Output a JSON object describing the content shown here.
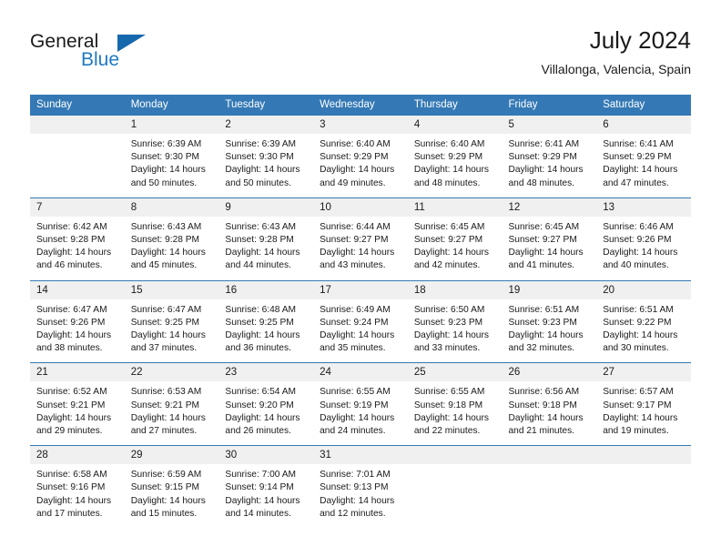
{
  "brand": {
    "name_part1": "General",
    "name_part2": "Blue",
    "triangle_icon": "triangle-icon",
    "accent_color": "#1668ad"
  },
  "header": {
    "title": "July 2024",
    "location": "Villalonga, Valencia, Spain"
  },
  "colors": {
    "header_row_bg": "#3479b5",
    "daynum_bg": "#f0f0f0",
    "week_divider": "#3479b5",
    "text": "#1a1a1a",
    "header_text": "#ffffff"
  },
  "weekdays": [
    "Sunday",
    "Monday",
    "Tuesday",
    "Wednesday",
    "Thursday",
    "Friday",
    "Saturday"
  ],
  "weeks": [
    [
      {
        "day": "",
        "lines": []
      },
      {
        "day": "1",
        "lines": [
          "Sunrise: 6:39 AM",
          "Sunset: 9:30 PM",
          "Daylight: 14 hours",
          "and 50 minutes."
        ]
      },
      {
        "day": "2",
        "lines": [
          "Sunrise: 6:39 AM",
          "Sunset: 9:30 PM",
          "Daylight: 14 hours",
          "and 50 minutes."
        ]
      },
      {
        "day": "3",
        "lines": [
          "Sunrise: 6:40 AM",
          "Sunset: 9:29 PM",
          "Daylight: 14 hours",
          "and 49 minutes."
        ]
      },
      {
        "day": "4",
        "lines": [
          "Sunrise: 6:40 AM",
          "Sunset: 9:29 PM",
          "Daylight: 14 hours",
          "and 48 minutes."
        ]
      },
      {
        "day": "5",
        "lines": [
          "Sunrise: 6:41 AM",
          "Sunset: 9:29 PM",
          "Daylight: 14 hours",
          "and 48 minutes."
        ]
      },
      {
        "day": "6",
        "lines": [
          "Sunrise: 6:41 AM",
          "Sunset: 9:29 PM",
          "Daylight: 14 hours",
          "and 47 minutes."
        ]
      }
    ],
    [
      {
        "day": "7",
        "lines": [
          "Sunrise: 6:42 AM",
          "Sunset: 9:28 PM",
          "Daylight: 14 hours",
          "and 46 minutes."
        ]
      },
      {
        "day": "8",
        "lines": [
          "Sunrise: 6:43 AM",
          "Sunset: 9:28 PM",
          "Daylight: 14 hours",
          "and 45 minutes."
        ]
      },
      {
        "day": "9",
        "lines": [
          "Sunrise: 6:43 AM",
          "Sunset: 9:28 PM",
          "Daylight: 14 hours",
          "and 44 minutes."
        ]
      },
      {
        "day": "10",
        "lines": [
          "Sunrise: 6:44 AM",
          "Sunset: 9:27 PM",
          "Daylight: 14 hours",
          "and 43 minutes."
        ]
      },
      {
        "day": "11",
        "lines": [
          "Sunrise: 6:45 AM",
          "Sunset: 9:27 PM",
          "Daylight: 14 hours",
          "and 42 minutes."
        ]
      },
      {
        "day": "12",
        "lines": [
          "Sunrise: 6:45 AM",
          "Sunset: 9:27 PM",
          "Daylight: 14 hours",
          "and 41 minutes."
        ]
      },
      {
        "day": "13",
        "lines": [
          "Sunrise: 6:46 AM",
          "Sunset: 9:26 PM",
          "Daylight: 14 hours",
          "and 40 minutes."
        ]
      }
    ],
    [
      {
        "day": "14",
        "lines": [
          "Sunrise: 6:47 AM",
          "Sunset: 9:26 PM",
          "Daylight: 14 hours",
          "and 38 minutes."
        ]
      },
      {
        "day": "15",
        "lines": [
          "Sunrise: 6:47 AM",
          "Sunset: 9:25 PM",
          "Daylight: 14 hours",
          "and 37 minutes."
        ]
      },
      {
        "day": "16",
        "lines": [
          "Sunrise: 6:48 AM",
          "Sunset: 9:25 PM",
          "Daylight: 14 hours",
          "and 36 minutes."
        ]
      },
      {
        "day": "17",
        "lines": [
          "Sunrise: 6:49 AM",
          "Sunset: 9:24 PM",
          "Daylight: 14 hours",
          "and 35 minutes."
        ]
      },
      {
        "day": "18",
        "lines": [
          "Sunrise: 6:50 AM",
          "Sunset: 9:23 PM",
          "Daylight: 14 hours",
          "and 33 minutes."
        ]
      },
      {
        "day": "19",
        "lines": [
          "Sunrise: 6:51 AM",
          "Sunset: 9:23 PM",
          "Daylight: 14 hours",
          "and 32 minutes."
        ]
      },
      {
        "day": "20",
        "lines": [
          "Sunrise: 6:51 AM",
          "Sunset: 9:22 PM",
          "Daylight: 14 hours",
          "and 30 minutes."
        ]
      }
    ],
    [
      {
        "day": "21",
        "lines": [
          "Sunrise: 6:52 AM",
          "Sunset: 9:21 PM",
          "Daylight: 14 hours",
          "and 29 minutes."
        ]
      },
      {
        "day": "22",
        "lines": [
          "Sunrise: 6:53 AM",
          "Sunset: 9:21 PM",
          "Daylight: 14 hours",
          "and 27 minutes."
        ]
      },
      {
        "day": "23",
        "lines": [
          "Sunrise: 6:54 AM",
          "Sunset: 9:20 PM",
          "Daylight: 14 hours",
          "and 26 minutes."
        ]
      },
      {
        "day": "24",
        "lines": [
          "Sunrise: 6:55 AM",
          "Sunset: 9:19 PM",
          "Daylight: 14 hours",
          "and 24 minutes."
        ]
      },
      {
        "day": "25",
        "lines": [
          "Sunrise: 6:55 AM",
          "Sunset: 9:18 PM",
          "Daylight: 14 hours",
          "and 22 minutes."
        ]
      },
      {
        "day": "26",
        "lines": [
          "Sunrise: 6:56 AM",
          "Sunset: 9:18 PM",
          "Daylight: 14 hours",
          "and 21 minutes."
        ]
      },
      {
        "day": "27",
        "lines": [
          "Sunrise: 6:57 AM",
          "Sunset: 9:17 PM",
          "Daylight: 14 hours",
          "and 19 minutes."
        ]
      }
    ],
    [
      {
        "day": "28",
        "lines": [
          "Sunrise: 6:58 AM",
          "Sunset: 9:16 PM",
          "Daylight: 14 hours",
          "and 17 minutes."
        ]
      },
      {
        "day": "29",
        "lines": [
          "Sunrise: 6:59 AM",
          "Sunset: 9:15 PM",
          "Daylight: 14 hours",
          "and 15 minutes."
        ]
      },
      {
        "day": "30",
        "lines": [
          "Sunrise: 7:00 AM",
          "Sunset: 9:14 PM",
          "Daylight: 14 hours",
          "and 14 minutes."
        ]
      },
      {
        "day": "31",
        "lines": [
          "Sunrise: 7:01 AM",
          "Sunset: 9:13 PM",
          "Daylight: 14 hours",
          "and 12 minutes."
        ]
      },
      {
        "day": "",
        "lines": []
      },
      {
        "day": "",
        "lines": []
      },
      {
        "day": "",
        "lines": []
      }
    ]
  ]
}
